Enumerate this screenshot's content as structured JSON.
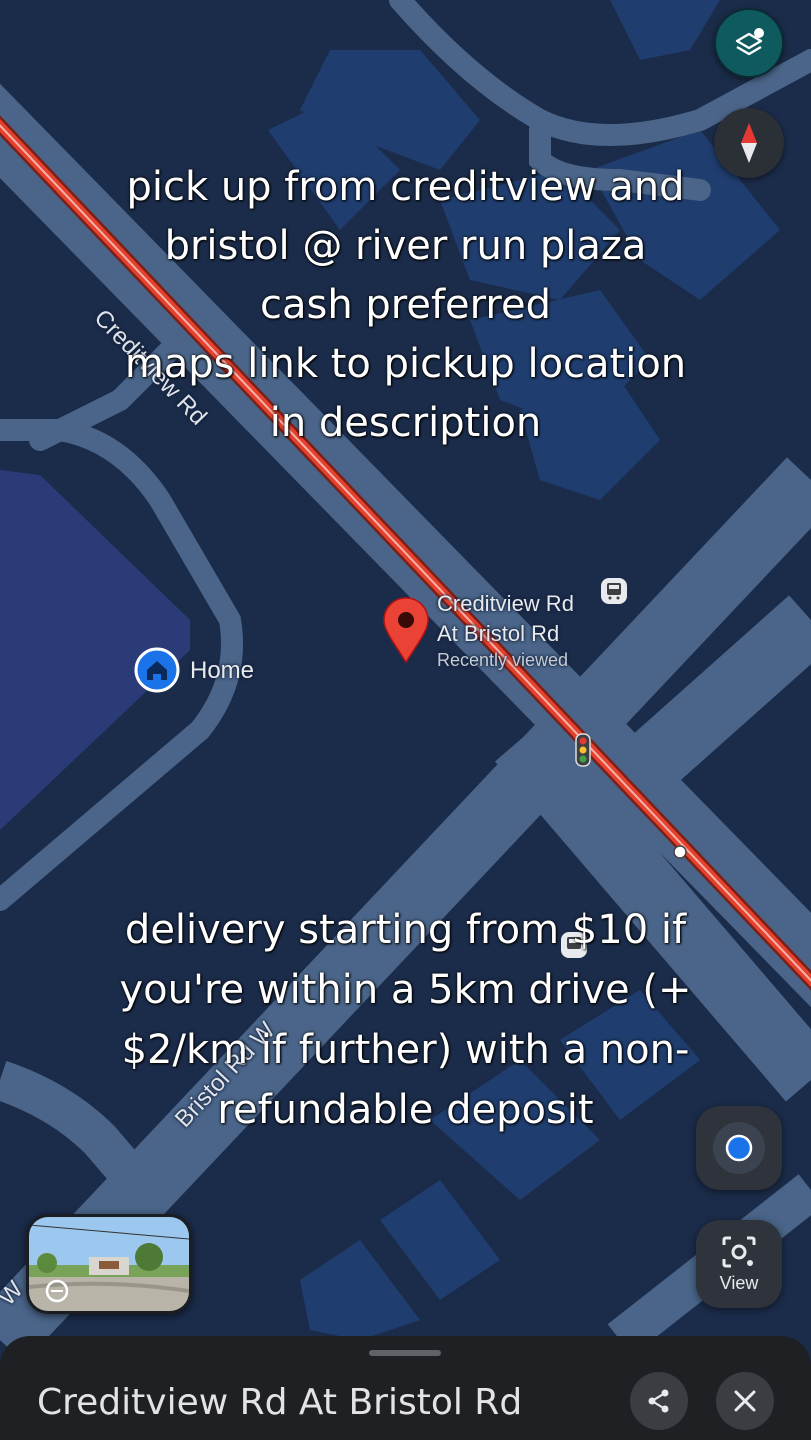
{
  "overlay": {
    "top_text": "pick up from creditview and\nbristol @ river run plaza\ncash preferred\nmaps link to pickup location\nin description",
    "bottom_text": "delivery starting from $10 if\nyou're within a 5km drive (+\n$2/km if further) with a non-\nrefundable deposit"
  },
  "map": {
    "road_label_creditview": "Creditview Rd",
    "road_label_bristol": "Bristol Rd W",
    "road_label_edge": "W",
    "pin_title_line1": "Creditview Rd",
    "pin_title_line2": "At Bristol Rd",
    "pin_subtitle": "Recently viewed",
    "home_label": "Home"
  },
  "controls": {
    "view_label": "View",
    "layers_icon": "layers-icon",
    "compass_icon": "compass-icon",
    "locate_icon": "my-location-icon",
    "share_icon": "share-icon",
    "close_icon": "close-icon"
  },
  "bottom_sheet": {
    "title": "Creditview Rd At Bristol Rd"
  },
  "colors": {
    "map_background": "#1b2c4a",
    "road": "#4a6589",
    "route": "#e5412d",
    "building": "#1f3d6e",
    "accent_blue": "#1a73e8",
    "pin_red": "#ea4335",
    "sheet_background": "#1e2023"
  }
}
